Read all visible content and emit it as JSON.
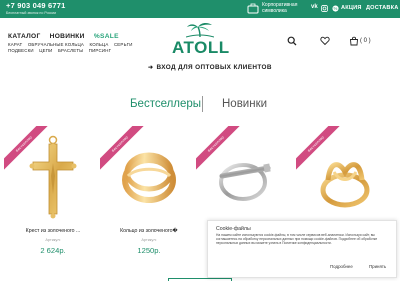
{
  "topbar": {
    "phone": "+7 903 049 6771",
    "phone_note": "Бесплатный звонок по России",
    "corporate_line1": "Корпоративная",
    "corporate_line2": "символика",
    "vk": "vk",
    "promo": "АКЦИЯ",
    "delivery": "ДОСТАВКА"
  },
  "nav": {
    "main": [
      "КАТАЛОГ",
      "НОВИНКИ",
      "%SALE"
    ],
    "sub": [
      "КАРАТ",
      "ОБРУЧАЛЬНЫЕ КОЛЬЦА",
      "КОЛЬЦА",
      "СЕРЬГИ",
      "ПОДВЕСКИ",
      "ЦЕПИ",
      "БРАСЛЕТЫ",
      "ПИРСИНГ"
    ]
  },
  "logo": {
    "text": "ATOLL"
  },
  "header": {
    "cart_count": "( 0 )"
  },
  "wholesale": {
    "label": "ВХОД ДЛЯ ОПТОВЫХ КЛИЕНТОВ"
  },
  "tabs": [
    {
      "label": "Бестселлеры",
      "active": true
    },
    {
      "label": "Новинки",
      "active": false
    }
  ],
  "products": [
    {
      "ribbon": "бестселлер",
      "name": "Крест из золоченого ...",
      "article": "Артикул:",
      "price": "2 624р.",
      "image_icon": "gold-cross-icon"
    },
    {
      "ribbon": "бестселлер",
      "name": "Кольцо из золоченого�",
      "article": "Артикул:",
      "price": "1250р.",
      "image_icon": "gold-ring-icon"
    },
    {
      "ribbon": "бестселлер",
      "name": "",
      "article": "",
      "price": "",
      "image_icon": "silver-ring-icon"
    },
    {
      "ribbon": "бестселлер",
      "name": "",
      "article": "",
      "price": "",
      "image_icon": "gold-knot-ring-icon"
    }
  ],
  "cookie": {
    "title": "Cookie-файлы",
    "text": "На нашем сайте используются cookie-файлы, в том числе сервисов веб-аналитики. Используя сайт, вы соглашаетесь на обработку персональных данных при помощи cookie-файлов. Подробнее об обработке персональных данных вы можете узнать в Политике конфиденциальности.",
    "more_label": "Подробнее",
    "accept_label": "Принять"
  },
  "colors": {
    "brand": "#1f8f6b",
    "ribbon": "#d14b81"
  }
}
